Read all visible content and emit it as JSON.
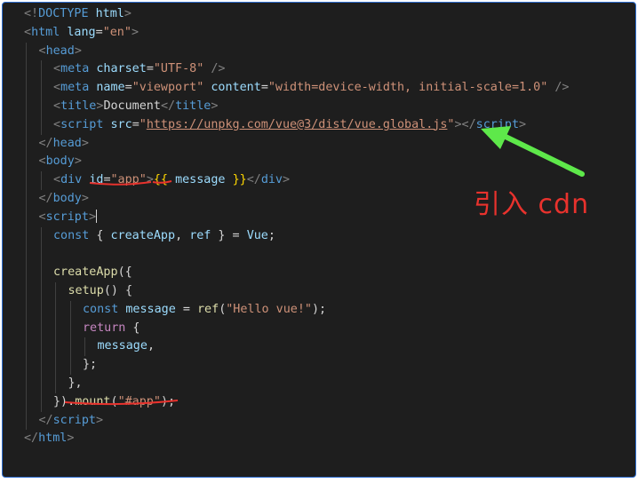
{
  "editor": {
    "lines": [
      {
        "indent": 0,
        "tokens": [
          [
            "punc",
            "<!"
          ],
          [
            "tag",
            "DOCTYPE"
          ],
          [
            "txt",
            " "
          ],
          [
            "attr",
            "html"
          ],
          [
            "punc",
            ">"
          ]
        ]
      },
      {
        "indent": 0,
        "tokens": [
          [
            "punc",
            "<"
          ],
          [
            "tag",
            "html"
          ],
          [
            "txt",
            " "
          ],
          [
            "attr",
            "lang"
          ],
          [
            "txt",
            "="
          ],
          [
            "str",
            "\"en\""
          ],
          [
            "punc",
            ">"
          ]
        ]
      },
      {
        "indent": 1,
        "tokens": [
          [
            "punc",
            "<"
          ],
          [
            "tag",
            "head"
          ],
          [
            "punc",
            ">"
          ]
        ]
      },
      {
        "indent": 2,
        "tokens": [
          [
            "punc",
            "<"
          ],
          [
            "tag",
            "meta"
          ],
          [
            "txt",
            " "
          ],
          [
            "attr",
            "charset"
          ],
          [
            "txt",
            "="
          ],
          [
            "str",
            "\"UTF-8\""
          ],
          [
            "txt",
            " "
          ],
          [
            "punc",
            "/>"
          ]
        ]
      },
      {
        "indent": 2,
        "tokens": [
          [
            "punc",
            "<"
          ],
          [
            "tag",
            "meta"
          ],
          [
            "txt",
            " "
          ],
          [
            "attr",
            "name"
          ],
          [
            "txt",
            "="
          ],
          [
            "str",
            "\"viewport\""
          ],
          [
            "txt",
            " "
          ],
          [
            "attr",
            "content"
          ],
          [
            "txt",
            "="
          ],
          [
            "str",
            "\"width=device-width, initial-scale=1.0\""
          ],
          [
            "txt",
            " "
          ],
          [
            "punc",
            "/>"
          ]
        ]
      },
      {
        "indent": 2,
        "tokens": [
          [
            "punc",
            "<"
          ],
          [
            "tag",
            "title"
          ],
          [
            "punc",
            ">"
          ],
          [
            "txt",
            "Document"
          ],
          [
            "punc",
            "</"
          ],
          [
            "tag",
            "title"
          ],
          [
            "punc",
            ">"
          ]
        ]
      },
      {
        "indent": 2,
        "tokens": [
          [
            "punc",
            "<"
          ],
          [
            "tag",
            "script"
          ],
          [
            "txt",
            " "
          ],
          [
            "attr",
            "src"
          ],
          [
            "txt",
            "="
          ],
          [
            "str",
            "\""
          ],
          [
            "str link",
            "https://unpkg.com/vue@3/dist/vue.global.js"
          ],
          [
            "str",
            "\""
          ],
          [
            "punc",
            "></"
          ],
          [
            "tag",
            "script"
          ],
          [
            "punc",
            ">"
          ]
        ]
      },
      {
        "indent": 1,
        "tokens": [
          [
            "punc",
            "</"
          ],
          [
            "tag",
            "head"
          ],
          [
            "punc",
            ">"
          ]
        ]
      },
      {
        "indent": 1,
        "tokens": [
          [
            "punc",
            "<"
          ],
          [
            "tag",
            "body"
          ],
          [
            "punc",
            ">"
          ]
        ]
      },
      {
        "indent": 2,
        "tokens": [
          [
            "punc",
            "<"
          ],
          [
            "tag",
            "div"
          ],
          [
            "txt",
            " "
          ],
          [
            "attr",
            "id"
          ],
          [
            "txt",
            "="
          ],
          [
            "str",
            "\"app\""
          ],
          [
            "punc",
            ">"
          ],
          [
            "brace",
            "{{"
          ],
          [
            "txt",
            " "
          ],
          [
            "var",
            "message"
          ],
          [
            "txt",
            " "
          ],
          [
            "brace",
            "}}"
          ],
          [
            "punc",
            "</"
          ],
          [
            "tag",
            "div"
          ],
          [
            "punc",
            ">"
          ]
        ]
      },
      {
        "indent": 1,
        "tokens": [
          [
            "punc",
            "</"
          ],
          [
            "tag",
            "body"
          ],
          [
            "punc",
            ">"
          ]
        ]
      },
      {
        "indent": 1,
        "tokens": [
          [
            "punc",
            "<"
          ],
          [
            "tag",
            "script"
          ],
          [
            "punc",
            ">"
          ]
        ],
        "cursor": true
      },
      {
        "indent": 2,
        "tokens": [
          [
            "decl",
            "const"
          ],
          [
            "txt",
            " { "
          ],
          [
            "var",
            "createApp"
          ],
          [
            "txt",
            ", "
          ],
          [
            "var",
            "ref"
          ],
          [
            "txt",
            " } = "
          ],
          [
            "var",
            "Vue"
          ],
          [
            "txt",
            ";"
          ]
        ]
      },
      {
        "indent": 2,
        "tokens": []
      },
      {
        "indent": 2,
        "tokens": [
          [
            "fn",
            "createApp"
          ],
          [
            "txt",
            "({"
          ]
        ]
      },
      {
        "indent": 3,
        "tokens": [
          [
            "fn",
            "setup"
          ],
          [
            "txt",
            "() {"
          ]
        ]
      },
      {
        "indent": 4,
        "tokens": [
          [
            "decl",
            "const"
          ],
          [
            "txt",
            " "
          ],
          [
            "var",
            "message"
          ],
          [
            "txt",
            " = "
          ],
          [
            "fn",
            "ref"
          ],
          [
            "txt",
            "("
          ],
          [
            "str",
            "\"Hello vue!\""
          ],
          [
            "txt",
            ");"
          ]
        ]
      },
      {
        "indent": 4,
        "tokens": [
          [
            "kw",
            "return"
          ],
          [
            "txt",
            " {"
          ]
        ]
      },
      {
        "indent": 5,
        "tokens": [
          [
            "var",
            "message"
          ],
          [
            "txt",
            ","
          ]
        ]
      },
      {
        "indent": 4,
        "tokens": [
          [
            "txt",
            "};"
          ]
        ]
      },
      {
        "indent": 3,
        "tokens": [
          [
            "txt",
            "},"
          ]
        ]
      },
      {
        "indent": 2,
        "tokens": [
          [
            "txt",
            "})."
          ],
          [
            "fn",
            "mount"
          ],
          [
            "txt",
            "("
          ],
          [
            "str",
            "\"#app\""
          ],
          [
            "txt",
            ");"
          ]
        ]
      },
      {
        "indent": 1,
        "tokens": [
          [
            "punc",
            "</"
          ],
          [
            "tag",
            "script"
          ],
          [
            "punc",
            ">"
          ]
        ]
      },
      {
        "indent": 0,
        "tokens": [
          [
            "punc",
            "</"
          ],
          [
            "tag",
            "html"
          ],
          [
            "punc",
            ">"
          ]
        ]
      }
    ]
  },
  "annotation": {
    "label": "引入 cdn",
    "color": "#e8322d",
    "arrow_color": "#5ee84a"
  }
}
